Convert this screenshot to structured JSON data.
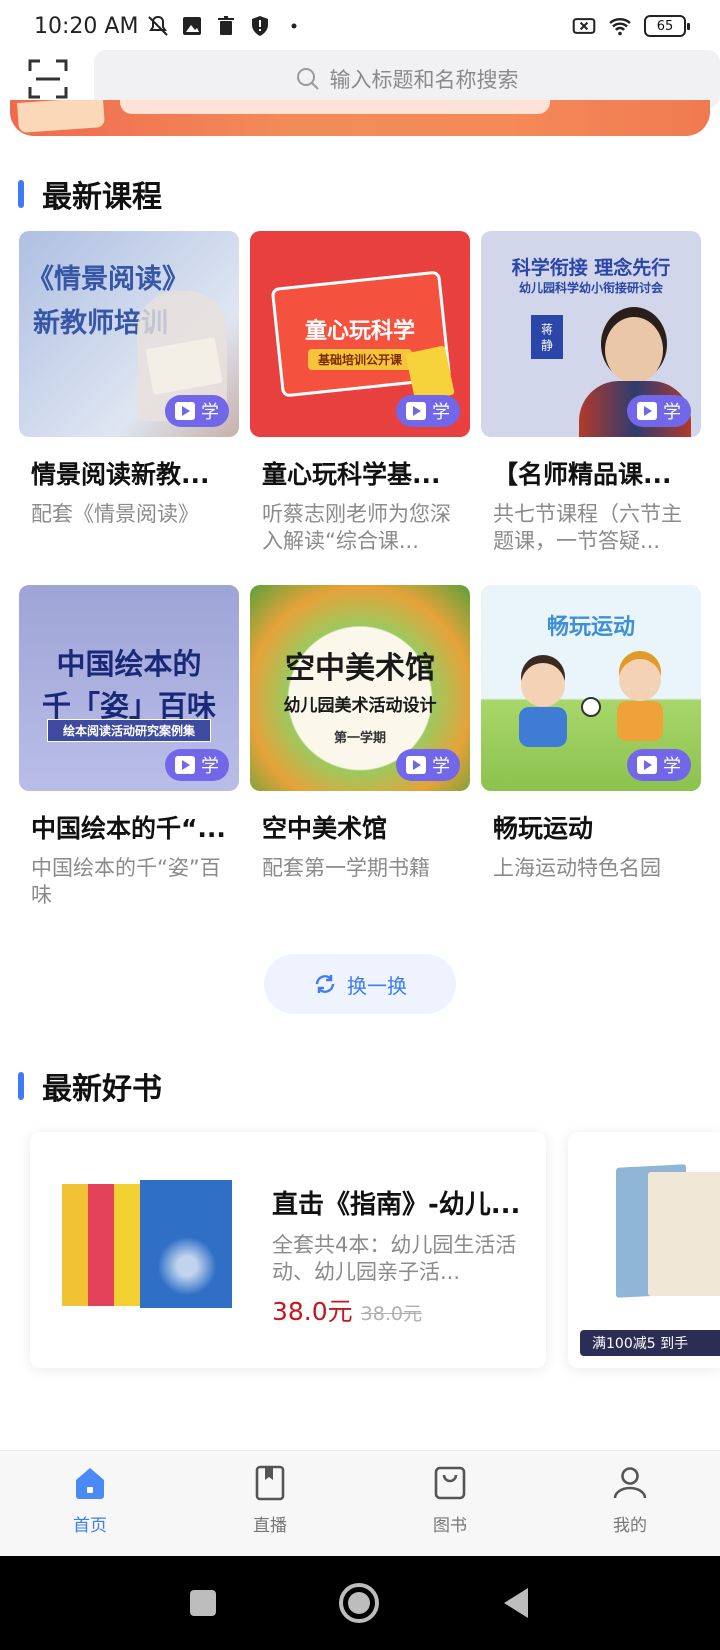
{
  "status": {
    "time": "10:20 AM",
    "battery": "65"
  },
  "search": {
    "placeholder": "输入标题和名称搜索"
  },
  "sections": {
    "courses_title": "最新课程",
    "books_title": "最新好书"
  },
  "courses": [
    {
      "title": "情景阅读新教...",
      "desc": "配套《情景阅读》",
      "badge": "学",
      "thumb_line1": "《情景阅读》",
      "thumb_line2": "新教师培训",
      "bg": "#b9c9e6"
    },
    {
      "title": "童心玩科学基...",
      "desc": "听蔡志刚老师为您深入解读“综合课...",
      "badge": "学",
      "thumb_line1": "童心玩科学",
      "thumb_line2": "基础培训公开课",
      "bg": "#e8403f"
    },
    {
      "title": "【名师精品课...",
      "desc": "共七节课程（六节主题课，一节答疑...",
      "badge": "学",
      "thumb_line1": "科学衔接 理念先行",
      "thumb_line2": "幼儿园科学幼小衔接研讨会",
      "thumb_name": "蒋 静",
      "bg": "#cfd3e6"
    },
    {
      "title": "中国绘本的千“...",
      "desc": "中国绘本的千“姿”百味",
      "badge": "学",
      "thumb_line1": "中国绘本的",
      "thumb_line2": "千「姿」百味",
      "thumb_line3": "绘本阅读活动研究案例集",
      "bg": "#a9aee0"
    },
    {
      "title": "空中美术馆",
      "desc": "配套第一学期书籍",
      "badge": "学",
      "thumb_line1": "空中美术馆",
      "thumb_line2": "幼儿园美术活动设计",
      "thumb_line3": "第一学期",
      "bg": "#f4f1e6"
    },
    {
      "title": "畅玩运动",
      "desc": "上海运动特色名园",
      "badge": "学",
      "thumb_line1": "畅玩运动",
      "bg": "#eaf4fb"
    }
  ],
  "refresh_label": "换一换",
  "books": [
    {
      "title": "直击《指南》-幼儿...",
      "desc": "全套共4本：幼儿园生活活动、幼儿园亲子活...",
      "price": "38.0元",
      "original_price": "38.0元"
    },
    {
      "promo": "满100减5 到手"
    }
  ],
  "nav": [
    {
      "label": "首页",
      "active": true
    },
    {
      "label": "直播",
      "active": false
    },
    {
      "label": "图书",
      "active": false
    },
    {
      "label": "我的",
      "active": false
    }
  ],
  "colors": {
    "accent": "#3f7cf3",
    "price": "#c8161d",
    "badge": "#7167e8"
  }
}
